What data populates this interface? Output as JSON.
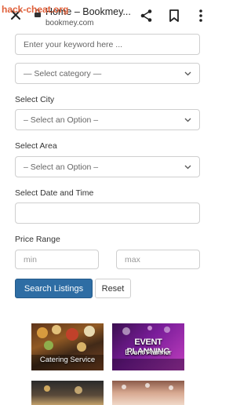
{
  "browser": {
    "title": "Home – Bookmey....",
    "domain": "bookmey.com",
    "watermark": "hack-cheat.org"
  },
  "form": {
    "keyword_placeholder": "Enter your keyword here ...",
    "category_value": "— Select category —",
    "city_label": "Select City",
    "city_value": "– Select an Option –",
    "area_label": "Select Area",
    "area_value": "– Select an Option –",
    "datetime_label": "Select Date and Time",
    "datetime_value": "",
    "price_label": "Price Range",
    "price_min_placeholder": "min",
    "price_max_placeholder": "max",
    "search_button": "Search Listings",
    "reset_button": "Reset"
  },
  "categories": [
    {
      "label": "Catering Service"
    },
    {
      "label": "Event Planner",
      "headline": "EVENT PLANNING"
    }
  ],
  "colors": {
    "primary_button": "#2e6da4",
    "watermark": "#e0603a"
  }
}
